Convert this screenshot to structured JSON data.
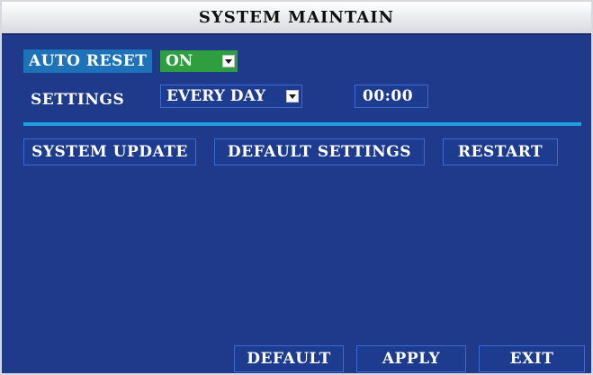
{
  "window": {
    "title": "SYSTEM MAINTAIN"
  },
  "auto_reset": {
    "label": "AUTO RESET",
    "value": "ON"
  },
  "settings": {
    "label": "SETTINGS",
    "frequency": "EVERY DAY",
    "time": "00:00"
  },
  "actions": {
    "system_update": "SYSTEM UPDATE",
    "default_settings": "DEFAULT SETTINGS",
    "restart": "RESTART"
  },
  "footer": {
    "default": "DEFAULT",
    "apply": "APPLY",
    "exit": "EXIT"
  },
  "colors": {
    "background": "#1f3a8a",
    "highlight": "#1d72b8",
    "toggle_on": "#2e9e3e",
    "divider": "#1fa0e0"
  },
  "icons": [
    "chevron-down-icon"
  ]
}
